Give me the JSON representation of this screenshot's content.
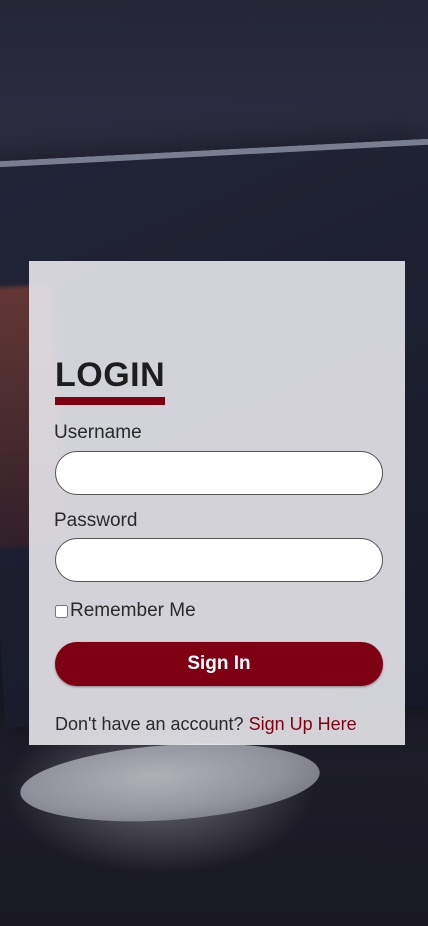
{
  "login": {
    "title": "LOGIN",
    "username_label": "Username",
    "username_value": "",
    "password_label": "Password",
    "password_value": "",
    "remember_label": "Remember Me",
    "remember_checked": false,
    "submit_label": "Sign In",
    "signup_prompt": "Don't have an account?",
    "signup_link": "Sign Up Here"
  },
  "colors": {
    "accent": "#800013",
    "card_bg": "#ececf0"
  }
}
